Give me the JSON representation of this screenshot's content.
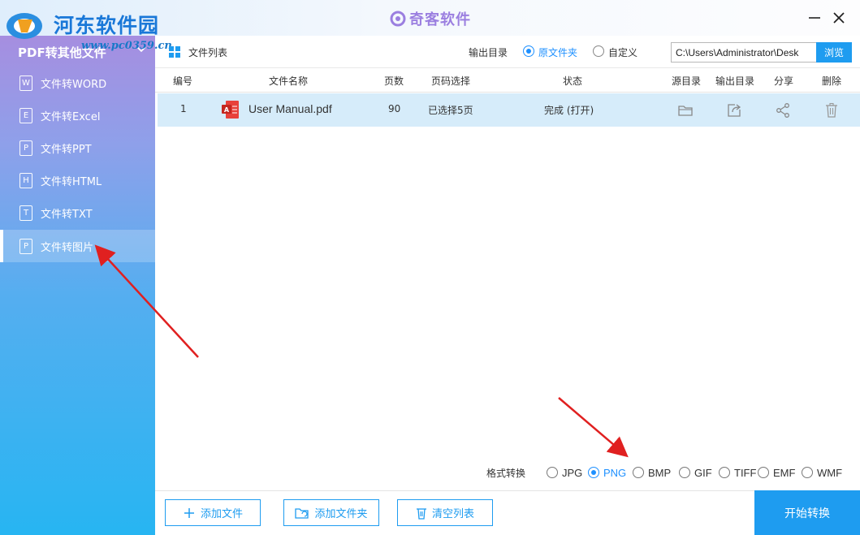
{
  "watermark": {
    "title": "河东软件园",
    "url": "www.pc0359.cn"
  },
  "app": {
    "brand": "奇客软件"
  },
  "sidebar": {
    "header": "PDF转其他文件",
    "items": [
      {
        "label": "文件转WORD",
        "glyph": "W"
      },
      {
        "label": "文件转Excel",
        "glyph": "E"
      },
      {
        "label": "文件转PPT",
        "glyph": "P"
      },
      {
        "label": "文件转HTML",
        "glyph": "H"
      },
      {
        "label": "文件转TXT",
        "glyph": "T"
      },
      {
        "label": "文件转图片",
        "glyph": "P"
      }
    ],
    "active_index": 5
  },
  "topbar": {
    "list_label": "文件列表",
    "output_label": "输出目录",
    "options": [
      {
        "label": "原文件夹",
        "selected": true
      },
      {
        "label": "自定义",
        "selected": false
      }
    ],
    "path_value": "C:\\Users\\Administrator\\Desk",
    "browse_label": "浏览"
  },
  "table": {
    "headers": [
      "编号",
      "文件名称",
      "页数",
      "页码选择",
      "状态",
      "源目录",
      "输出目录",
      "分享",
      "删除"
    ],
    "rows": [
      {
        "no": "1",
        "name": "User Manual.pdf",
        "pages": "90",
        "selection": "已选择5页",
        "status": "完成 (打开)"
      }
    ]
  },
  "format": {
    "label": "格式转换",
    "options": [
      {
        "label": "JPG",
        "selected": false
      },
      {
        "label": "PNG",
        "selected": true
      },
      {
        "label": "BMP",
        "selected": false
      },
      {
        "label": "GIF",
        "selected": false
      },
      {
        "label": "TIFF",
        "selected": false
      },
      {
        "label": "EMF",
        "selected": false
      },
      {
        "label": "WMF",
        "selected": false
      }
    ]
  },
  "bottom": {
    "add_file": "添加文件",
    "add_folder": "添加文件夹",
    "clear_list": "清空列表",
    "start": "开始转换"
  },
  "colors": {
    "accent": "#1e9cf0",
    "row_highlight": "#d6ecfa",
    "arrow": "#e02020"
  }
}
